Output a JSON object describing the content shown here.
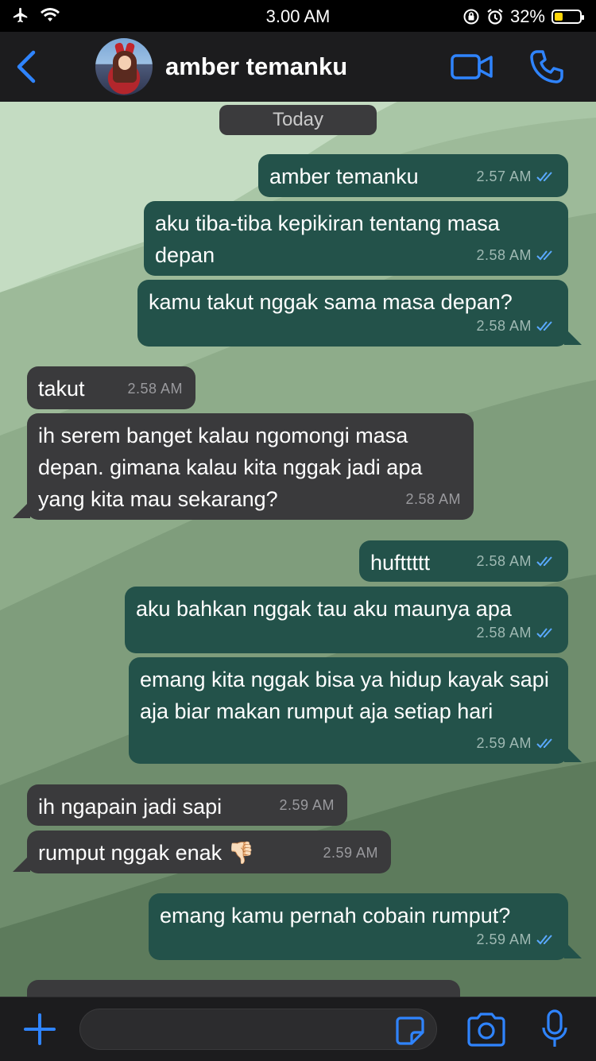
{
  "status_bar": {
    "time": "3.00 AM",
    "battery_percent": "32%",
    "battery_level": 0.32,
    "icons": [
      "airplane-icon",
      "wifi-icon",
      "orientation-lock-icon",
      "alarm-icon",
      "battery-icon"
    ]
  },
  "header": {
    "contact_name": "amber temanku",
    "icons": [
      "back-chevron-icon",
      "avatar",
      "video-call-icon",
      "phone-call-icon"
    ],
    "accent_color": "#2f84ff"
  },
  "chat": {
    "date_label": "Today",
    "messages": [
      {
        "dir": "out",
        "text": "amber temanku",
        "time": "2.57 AM",
        "read": true
      },
      {
        "dir": "out",
        "text": "aku tiba-tiba kepikiran tentang masa depan",
        "time": "2.58 AM",
        "read": true
      },
      {
        "dir": "out",
        "text": "kamu takut nggak sama masa depan?",
        "time": "2.58 AM",
        "read": true
      },
      {
        "dir": "in",
        "text": "takut",
        "time": "2.58 AM"
      },
      {
        "dir": "in",
        "text": "ih serem banget kalau ngomongi masa depan. gimana kalau kita nggak jadi apa yang kita mau sekarang?",
        "time": "2.58 AM"
      },
      {
        "dir": "out",
        "text": "hufttttt",
        "time": "2.58 AM",
        "read": true
      },
      {
        "dir": "out",
        "text": "aku bahkan nggak tau aku maunya apa",
        "time": "2.58 AM",
        "read": true
      },
      {
        "dir": "out",
        "text": "emang kita nggak bisa ya hidup kayak sapi aja biar makan rumput aja setiap hari",
        "time": "2.59 AM",
        "read": true
      },
      {
        "dir": "in",
        "text": "ih ngapain jadi sapi",
        "time": "2.59 AM"
      },
      {
        "dir": "in",
        "text": "rumput nggak enak 👎🏻",
        "time": "2.59 AM"
      },
      {
        "dir": "out",
        "text": "emang kamu pernah cobain rumput?",
        "time": "2.59 AM",
        "read": true
      }
    ],
    "colors": {
      "outgoing": "#23524a",
      "incoming": "#3a3a3c",
      "read_tick": "#5aa9ff"
    }
  },
  "composer": {
    "value": "",
    "icons": [
      "plus-icon",
      "sticker-icon",
      "camera-icon",
      "microphone-icon"
    ]
  }
}
